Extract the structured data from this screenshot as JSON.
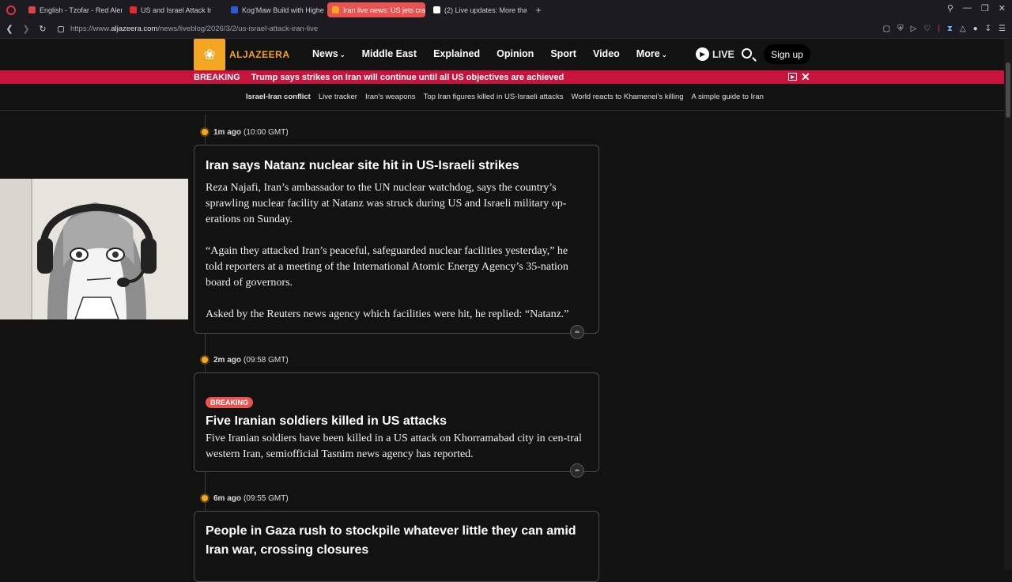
{
  "browser": {
    "tabs": [
      {
        "label": "English - Tzofar - Red Aler",
        "color": "#d9434a"
      },
      {
        "label": "US and Israel Attack Ir",
        "color": "#e22b2b"
      },
      {
        "label": "Kog'Maw Build with Highe",
        "color": "#2d5bd6"
      },
      {
        "label": "Iran live news: US jets cra",
        "color": "#f3a621"
      },
      {
        "label": "(2) Live updates: More tha",
        "color": "#ffffff"
      }
    ],
    "tab_add": "+",
    "url_prefix": "https://www.",
    "url_host": "aljazeera.com",
    "url_path": "/news/liveblog/2026/3/2/us-israel-attack-iran-live"
  },
  "header": {
    "logo_text": "ALJAZEERA",
    "nav": [
      "News",
      "Middle East",
      "Explained",
      "Opinion",
      "Sport",
      "Video",
      "More"
    ],
    "live_label": "LIVE",
    "signup_label": "Sign up"
  },
  "breaking": {
    "tag": "BREAKING",
    "headline": "Trump says strikes on Iran will continue until all US objectives are achieved"
  },
  "subnav": [
    "Israel-Iran conflict",
    "Live tracker",
    "Iran's weapons",
    "Top Iran figures killed in US-Israeli attacks",
    "World reacts to Khamenei's killing",
    "A simple guide to Iran"
  ],
  "posts": [
    {
      "ago": "1m ago",
      "time": "(10:00 GMT)",
      "title": "Iran says Natanz nuclear site hit in US-Israeli strikes",
      "paragraphs": [
        "Reza Najafi, Iran’s ambassador to the UN nuclear watchdog, says the country’s sprawling nuclear facility at Natanz was struck during US and Israeli military op-erations on Sunday.",
        "“Again they attacked Iran’s peaceful, safeguarded nuclear facilities yesterday,” he told reporters at a meeting of the International Atomic Energy Agency’s 35-nation board of governors.",
        "Asked by the Reuters news agency which facilities were hit, he replied: “Natanz.”"
      ]
    },
    {
      "ago": "2m ago",
      "time": "(09:58 GMT)",
      "badge": "BREAKING",
      "title": "Five Iranian soldiers killed in US attacks",
      "paragraphs": [
        "Five Iranian soldiers have been killed in a US attack on Khorramabad city in cen-tral western Iran, semiofficial Tasnim news agency has reported."
      ]
    },
    {
      "ago": "6m ago",
      "time": "(09:55 GMT)",
      "title": "People in Gaza rush to stockpile whatever little they can amid Iran war, crossing closures"
    }
  ],
  "colors": {
    "brand": "#f3a621",
    "breaking_bg": "#c8143c",
    "active_tab": "#e8524f"
  }
}
